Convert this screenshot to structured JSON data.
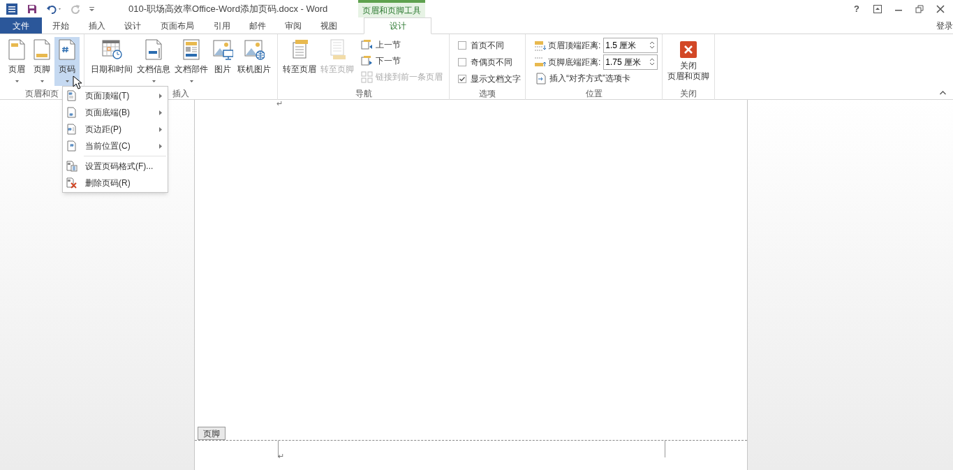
{
  "window": {
    "title": "010-职场高效率Office-Word添加页码.docx - Word",
    "contextual_group": "页眉和页脚工具",
    "help": "?",
    "sign_in": "登录"
  },
  "tabs": [
    {
      "label": "文件",
      "kind": "file",
      "selected": false
    },
    {
      "label": "开始",
      "kind": "normal",
      "selected": false
    },
    {
      "label": "插入",
      "kind": "normal",
      "selected": false
    },
    {
      "label": "设计",
      "kind": "normal",
      "selected": false
    },
    {
      "label": "页面布局",
      "kind": "normal",
      "selected": false
    },
    {
      "label": "引用",
      "kind": "normal",
      "selected": false
    },
    {
      "label": "邮件",
      "kind": "normal",
      "selected": false
    },
    {
      "label": "审阅",
      "kind": "normal",
      "selected": false
    },
    {
      "label": "视图",
      "kind": "normal",
      "selected": false
    },
    {
      "label": "设计",
      "kind": "contextual",
      "selected": true
    }
  ],
  "ribbon_groups": [
    {
      "label": "页眉和页",
      "items": [
        {
          "kind": "large",
          "label": "页眉",
          "dropdown": true,
          "disabled": false,
          "selected": false
        },
        {
          "kind": "large",
          "label": "页脚",
          "dropdown": true,
          "disabled": false,
          "selected": false
        },
        {
          "kind": "large",
          "label": "页码",
          "dropdown": true,
          "disabled": false,
          "selected": true
        }
      ]
    },
    {
      "label": "插入",
      "items": [
        {
          "kind": "large",
          "label": "日期和时间",
          "dropdown": false,
          "disabled": false,
          "selected": false
        },
        {
          "kind": "large",
          "label": "文档信息",
          "dropdown": true,
          "disabled": false,
          "selected": false
        },
        {
          "kind": "large",
          "label": "文档部件",
          "dropdown": true,
          "disabled": false,
          "selected": false
        },
        {
          "kind": "large",
          "label": "图片",
          "dropdown": false,
          "disabled": false,
          "selected": false
        },
        {
          "kind": "large",
          "label": "联机图片",
          "dropdown": false,
          "disabled": false,
          "selected": false
        }
      ]
    },
    {
      "label": "导航",
      "items": [
        {
          "kind": "large",
          "label": "转至页眉",
          "dropdown": false,
          "disabled": false,
          "selected": false
        },
        {
          "kind": "large",
          "label": "转至页脚",
          "dropdown": false,
          "disabled": true,
          "selected": false
        },
        {
          "kind": "small",
          "label": "上一节",
          "disabled": false
        },
        {
          "kind": "small",
          "label": "下一节",
          "disabled": false
        },
        {
          "kind": "small",
          "label": "链接到前一条页眉",
          "disabled": true
        }
      ]
    },
    {
      "label": "选项",
      "items": [
        {
          "kind": "checkbox",
          "label": "首页不同",
          "checked": false
        },
        {
          "kind": "checkbox",
          "label": "奇偶页不同",
          "checked": false
        },
        {
          "kind": "checkbox",
          "label": "显示文档文字",
          "checked": true
        }
      ]
    },
    {
      "label": "位置",
      "items": [
        {
          "kind": "spinner",
          "label": "页眉顶端距离:",
          "value": "1.5 厘米"
        },
        {
          "kind": "spinner",
          "label": "页脚底端距离:",
          "value": "1.75 厘米"
        },
        {
          "kind": "small",
          "label": "插入“对齐方式”选项卡",
          "disabled": false
        }
      ]
    },
    {
      "label": "关闭",
      "items": [
        {
          "kind": "close",
          "lines": [
            "关闭",
            "页眉和页脚"
          ]
        }
      ]
    }
  ],
  "page_number_menu": [
    {
      "label": "页面顶端(T)",
      "submenu": true
    },
    {
      "label": "页面底端(B)",
      "submenu": true
    },
    {
      "label": "页边距(P)",
      "submenu": true
    },
    {
      "label": "当前位置(C)",
      "submenu": true
    },
    {
      "label": "设置页码格式(F)...",
      "submenu": false
    },
    {
      "label": "删除页码(R)",
      "submenu": false
    }
  ],
  "document": {
    "top_mark": "↵",
    "footer_tag": "页脚",
    "footer_mark": "↵"
  }
}
